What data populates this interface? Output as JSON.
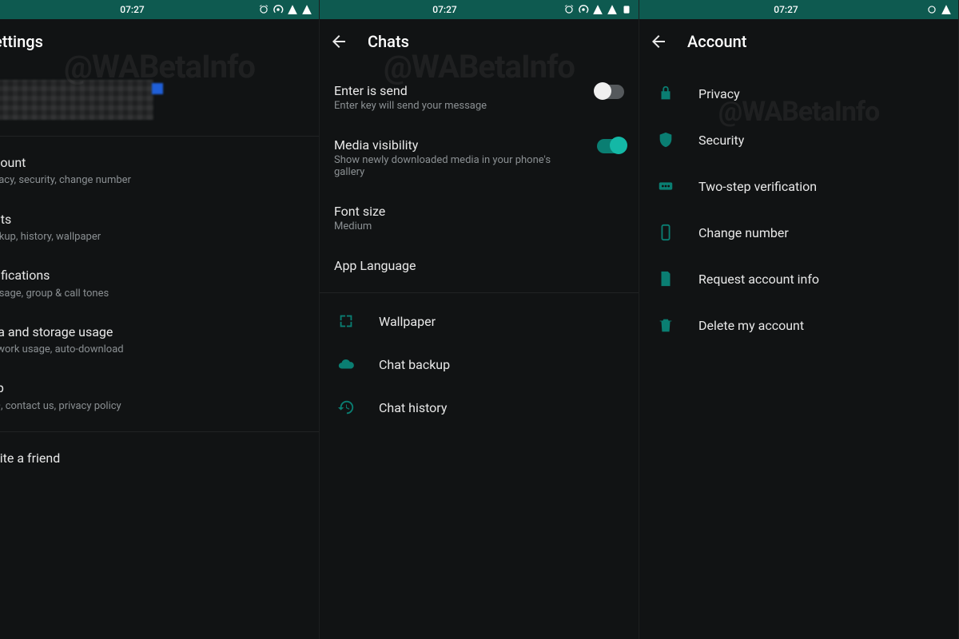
{
  "status_bar": {
    "time": "07:27"
  },
  "watermark": "@WABetaInfo",
  "screens": {
    "settings": {
      "title": "ettings",
      "items": [
        {
          "title": "count",
          "sub": "vacy, security, change number"
        },
        {
          "title": "ats",
          "sub": "ckup, history, wallpaper"
        },
        {
          "title": "tifications",
          "sub": "ssage, group & call tones"
        },
        {
          "title": "ta and storage usage",
          "sub": "twork usage, auto-download"
        },
        {
          "title": "lp",
          "sub": "Q, contact us, privacy policy"
        },
        {
          "title": "vite a friend",
          "sub": ""
        }
      ]
    },
    "chats": {
      "title": "Chats",
      "enter_is_send": {
        "title": "Enter is send",
        "sub": "Enter key will send your message"
      },
      "media_visibility": {
        "title": "Media visibility",
        "sub": "Show newly downloaded media in your phone's gallery"
      },
      "font_size": {
        "title": "Font size",
        "sub": "Medium"
      },
      "app_language": {
        "title": "App Language"
      },
      "wallpaper": "Wallpaper",
      "chat_backup": "Chat backup",
      "chat_history": "Chat history"
    },
    "account": {
      "title": "Account",
      "items": [
        "Privacy",
        "Security",
        "Two-step verification",
        "Change number",
        "Request account info",
        "Delete my account"
      ]
    }
  }
}
